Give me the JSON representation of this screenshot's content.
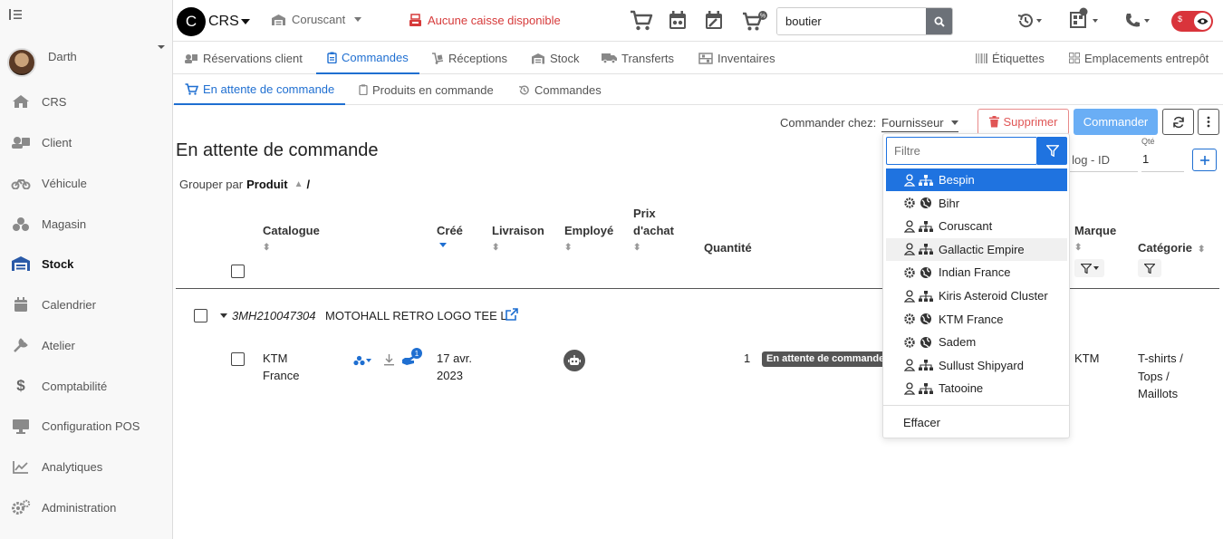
{
  "sidebar": {
    "user_name": "Darth",
    "items": [
      {
        "label": "CRS",
        "icon": "home-icon"
      },
      {
        "label": "Client",
        "icon": "client-icon"
      },
      {
        "label": "Véhicule",
        "icon": "motorcycle-icon"
      },
      {
        "label": "Magasin",
        "icon": "store-icon"
      },
      {
        "label": "Stock",
        "icon": "warehouse-icon",
        "active": true
      },
      {
        "label": "Calendrier",
        "icon": "calendar-icon"
      },
      {
        "label": "Atelier",
        "icon": "wrench-icon"
      },
      {
        "label": "Comptabilité",
        "icon": "dollar-icon"
      },
      {
        "label": "Configuration POS",
        "icon": "monitor-icon"
      },
      {
        "label": "Analytiques",
        "icon": "chart-icon"
      },
      {
        "label": "Administration",
        "icon": "gears-icon"
      }
    ]
  },
  "topbar": {
    "logo_letter": "C",
    "app_name": "CRS",
    "store": "Coruscant",
    "cash_status": "Aucune caisse disponible",
    "search_value": "boutier",
    "toggle_label": "$"
  },
  "tabs": [
    {
      "label": "Réservations client"
    },
    {
      "label": "Commandes",
      "active": true
    },
    {
      "label": "Réceptions"
    },
    {
      "label": "Stock"
    },
    {
      "label": "Transferts"
    },
    {
      "label": "Inventaires"
    }
  ],
  "tabs_right": [
    {
      "label": "Étiquettes"
    },
    {
      "label": "Emplacements entrepôt"
    }
  ],
  "subtabs": [
    {
      "label": "En attente de commande",
      "active": true
    },
    {
      "label": "Produits en commande"
    },
    {
      "label": "Commandes"
    }
  ],
  "toolbar": {
    "order_from_label": "Commander chez:",
    "order_from_value": "Fournisseur",
    "delete_label": "Supprimer",
    "order_label": "Commander"
  },
  "page": {
    "title": "En attente de commande",
    "group_by_label": "Grouper par",
    "group_by_value": "Produit",
    "group_sep": "/"
  },
  "add_form": {
    "id_placeholder": "log - ID",
    "qty_label": "Qté",
    "qty_value": "1"
  },
  "table": {
    "headers": {
      "catalogue": "Catalogue",
      "cree": "Créé",
      "livraison": "Livraison",
      "employe": "Employé",
      "prix1": "Prix",
      "prix2": "d'achat",
      "quantite": "Quantité",
      "marque": "Marque",
      "categorie": "Catégorie"
    },
    "group": {
      "sku": "3MH210047304",
      "name": "MOTOHALL RETRO LOGO TEE L"
    },
    "row": {
      "catalogue_line1": "KTM",
      "catalogue_line2": "France",
      "badge_count": "1",
      "date_line1": "17 avr.",
      "date_line2": "2023",
      "quantity": "1",
      "status": "En attente de commande",
      "brand": "KTM",
      "category_line1": "T-shirts /",
      "category_line2": "Tops /",
      "category_line3": "Maillots"
    }
  },
  "dropdown": {
    "filter_placeholder": "Filtre",
    "clear_label": "Effacer",
    "options": [
      {
        "label": "Bespin",
        "kind": "supplier"
      },
      {
        "label": "Bihr",
        "kind": "global"
      },
      {
        "label": "Coruscant",
        "kind": "supplier"
      },
      {
        "label": "Gallactic Empire",
        "kind": "supplier"
      },
      {
        "label": "Indian France",
        "kind": "global"
      },
      {
        "label": "Kiris Asteroid Cluster",
        "kind": "supplier"
      },
      {
        "label": "KTM France",
        "kind": "global"
      },
      {
        "label": "Sadem",
        "kind": "global"
      },
      {
        "label": "Sullust Shipyard",
        "kind": "supplier"
      },
      {
        "label": "Tatooine",
        "kind": "supplier"
      }
    ]
  }
}
